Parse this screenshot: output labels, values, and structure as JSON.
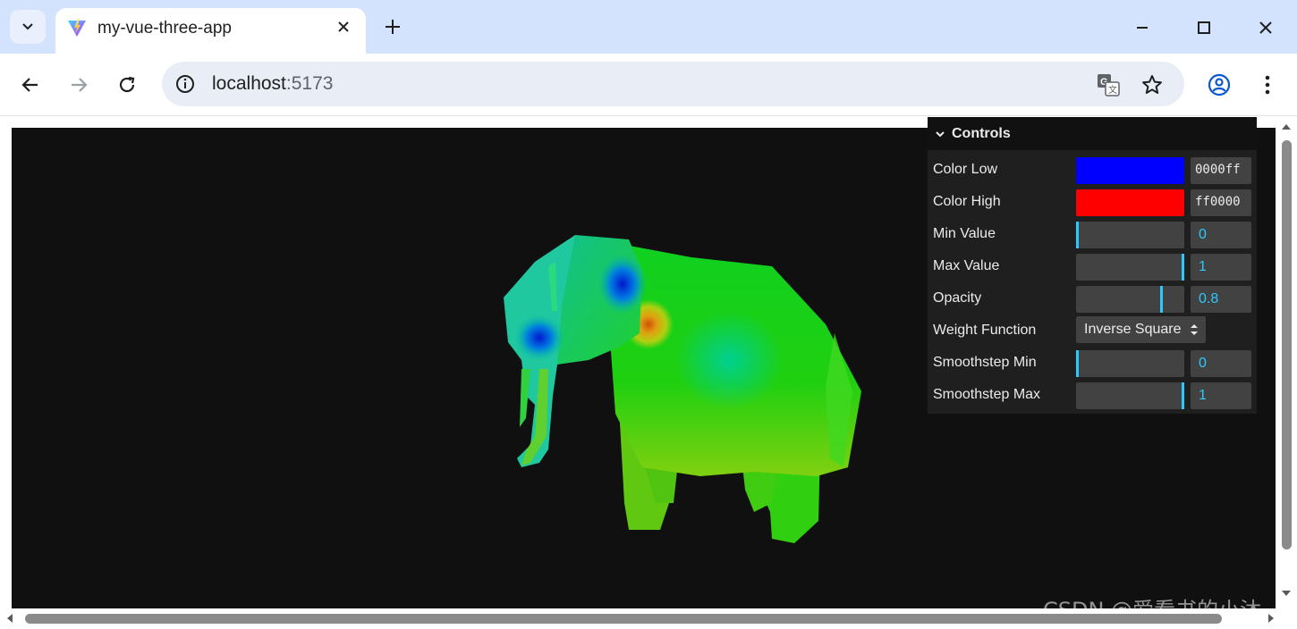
{
  "browser": {
    "tab_title": "my-vue-three-app",
    "url_host": "localhost",
    "url_port": ":5173"
  },
  "controls": {
    "title": "Controls",
    "color_low": {
      "label": "Color Low",
      "value": "0000ff",
      "color": "#0000ff"
    },
    "color_high": {
      "label": "Color High",
      "value": "ff0000",
      "color": "#ff0000"
    },
    "min_value": {
      "label": "Min Value",
      "value": "0",
      "level": 0
    },
    "max_value": {
      "label": "Max Value",
      "value": "1",
      "level": 1
    },
    "opacity": {
      "label": "Opacity",
      "value": "0.8",
      "level": 0.8
    },
    "weight_function": {
      "label": "Weight Function",
      "selected": "Inverse Square"
    },
    "smoothstep_min": {
      "label": "Smoothstep Min",
      "value": "0",
      "level": 0
    },
    "smoothstep_max": {
      "label": "Smoothstep Max",
      "value": "1",
      "level": 1
    }
  },
  "watermark": "CSDN @爱看书的小沐",
  "colors": {
    "canvas_bg": "#101010",
    "accent": "#2cc9ff",
    "tabstrip": "#d3e3fd"
  }
}
